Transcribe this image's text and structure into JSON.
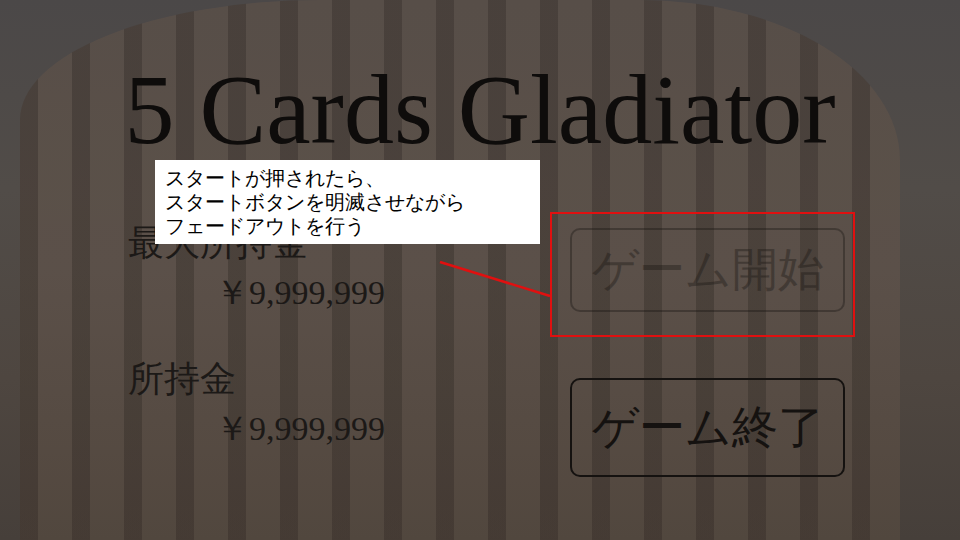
{
  "title": "5 Cards Gladiator",
  "stats": [
    {
      "label": "最大所持金",
      "value": "￥9,999,999"
    },
    {
      "label": "所持金",
      "value": "￥9,999,999"
    }
  ],
  "buttons": [
    {
      "label": "ゲーム開始",
      "fading": true
    },
    {
      "label": "ゲーム終了",
      "fading": false
    }
  ],
  "annotation": {
    "lines": [
      "スタートが押されたら、",
      "スタートボタンを明滅させながら",
      "フェードアウトを行う"
    ]
  }
}
